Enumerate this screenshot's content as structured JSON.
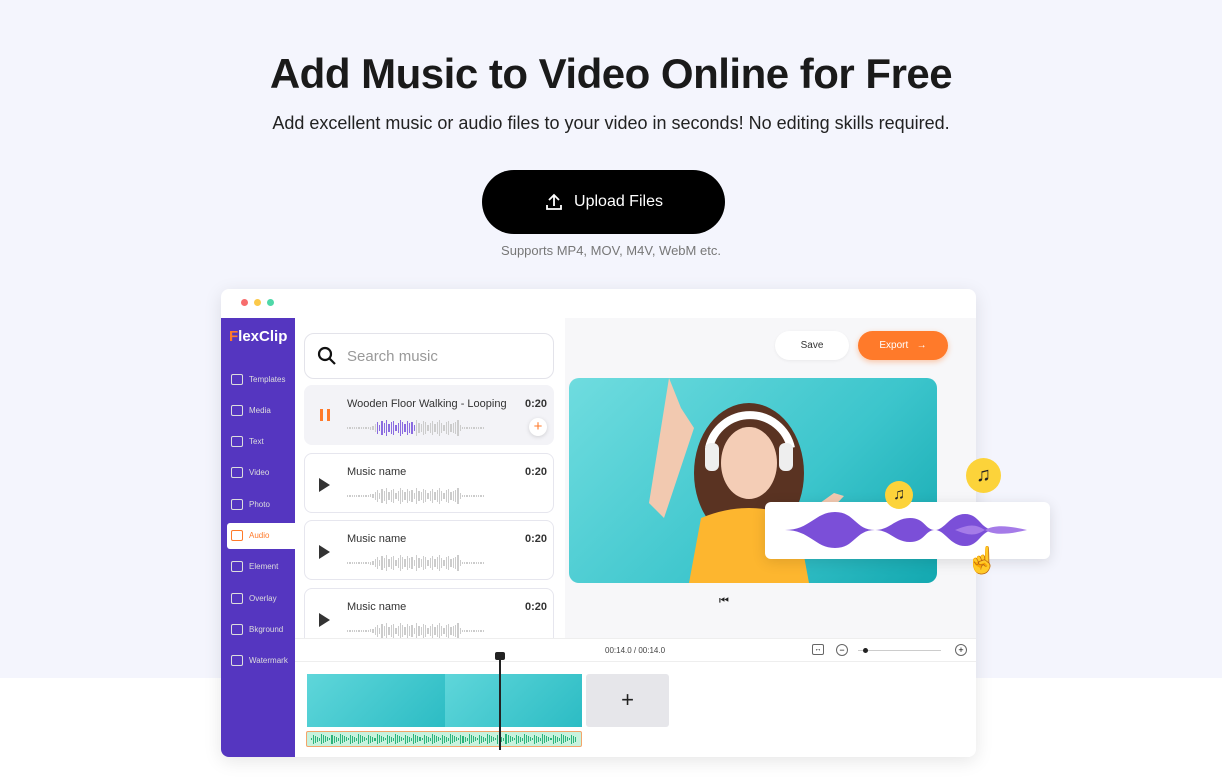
{
  "hero": {
    "title": "Add Music to Video Online for Free",
    "subtitle": "Add excellent music or audio files to your video in seconds! No editing skills required.",
    "upload_label": "Upload Files",
    "supports": "Supports MP4, MOV, M4V, WebM etc."
  },
  "app": {
    "logo": "FlexClip",
    "sidebar": [
      {
        "label": "Templates"
      },
      {
        "label": "Media"
      },
      {
        "label": "Text"
      },
      {
        "label": "Video"
      },
      {
        "label": "Photo"
      },
      {
        "label": "Audio",
        "active": true
      },
      {
        "label": "Element"
      },
      {
        "label": "Overlay"
      },
      {
        "label": "Bkground"
      },
      {
        "label": "Watermark"
      }
    ],
    "search_placeholder": "Search music",
    "tracks": [
      {
        "name": "Wooden Floor Walking - Looping",
        "duration": "0:20",
        "playing": true
      },
      {
        "name": "Music name",
        "duration": "0:20"
      },
      {
        "name": "Music name",
        "duration": "0:20"
      },
      {
        "name": "Music name",
        "duration": "0:20"
      }
    ],
    "save_label": "Save",
    "export_label": "Export",
    "time": "00:14.0 / 00:14.0",
    "colors": {
      "accent": "#ff7a2a",
      "sidebar": "#5536c0",
      "wave": "#7b4fd8",
      "note": "#fcd33a"
    }
  }
}
